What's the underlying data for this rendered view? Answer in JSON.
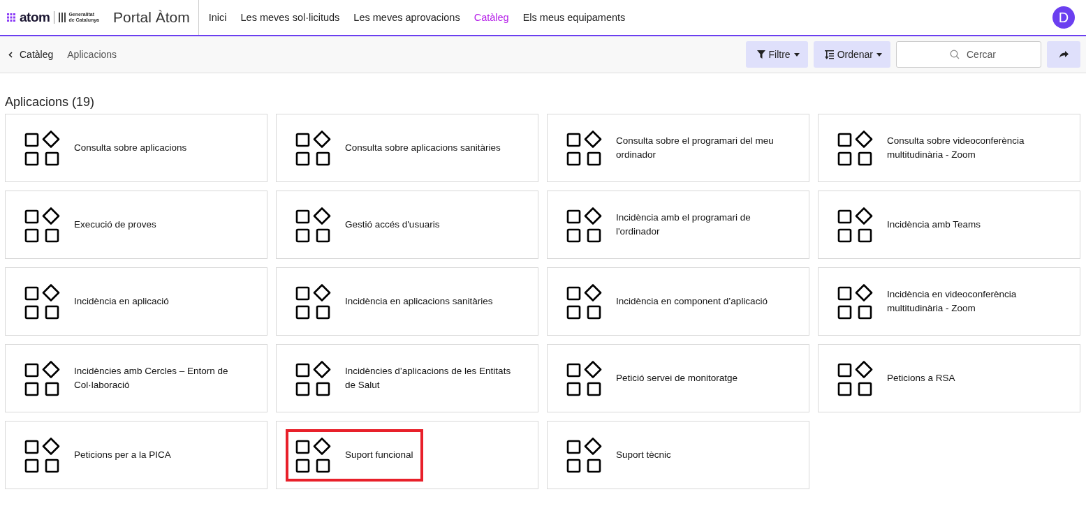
{
  "header": {
    "logo_text": "atom",
    "logo_org_lines": [
      "Generalitat",
      "de Catalunya"
    ],
    "portal_title": "Portal Àtom",
    "avatar_letter": "D"
  },
  "nav": [
    {
      "label": "Inici",
      "selected": false
    },
    {
      "label": "Les meves sol·licituds",
      "selected": false
    },
    {
      "label": "Les meves aprovacions",
      "selected": false
    },
    {
      "label": "Catàleg",
      "selected": true
    },
    {
      "label": "Els meus equipaments",
      "selected": false
    }
  ],
  "breadcrumb": {
    "back": "Catàleg",
    "current": "Aplicacions"
  },
  "toolbar": {
    "filter": "Filtre",
    "sort": "Ordenar",
    "search_placeholder": "Cercar"
  },
  "section_title": "Aplicacions (19)",
  "items": [
    {
      "label": "Consulta sobre aplicacions",
      "highlighted": false
    },
    {
      "label": "Consulta sobre aplicacions sanitàries",
      "highlighted": false
    },
    {
      "label": "Consulta sobre el programari del meu ordinador",
      "highlighted": false
    },
    {
      "label": "Consulta sobre videoconferència multitudinària - Zoom",
      "highlighted": false
    },
    {
      "label": "Execució de proves",
      "highlighted": false
    },
    {
      "label": "Gestió accés d'usuaris",
      "highlighted": false
    },
    {
      "label": "Incidència amb el programari de l'ordinador",
      "highlighted": false
    },
    {
      "label": "Incidència amb Teams",
      "highlighted": false
    },
    {
      "label": "Incidència en aplicació",
      "highlighted": false
    },
    {
      "label": "Incidència en aplicacions sanitàries",
      "highlighted": false
    },
    {
      "label": "Incidència en component d’aplicació",
      "highlighted": false
    },
    {
      "label": "Incidència en videoconferència multitudinària - Zoom",
      "highlighted": false
    },
    {
      "label": "Incidències amb Cercles – Entorn de Col·laboració",
      "highlighted": false
    },
    {
      "label": "Incidències d’aplicacions de les Entitats de Salut",
      "highlighted": false
    },
    {
      "label": "Petició servei de monitoratge",
      "highlighted": false
    },
    {
      "label": "Peticions a RSA",
      "highlighted": false
    },
    {
      "label": "Peticions per a la PICA",
      "highlighted": false
    },
    {
      "label": "Suport funcional",
      "highlighted": true
    },
    {
      "label": "Suport tècnic",
      "highlighted": false
    }
  ]
}
